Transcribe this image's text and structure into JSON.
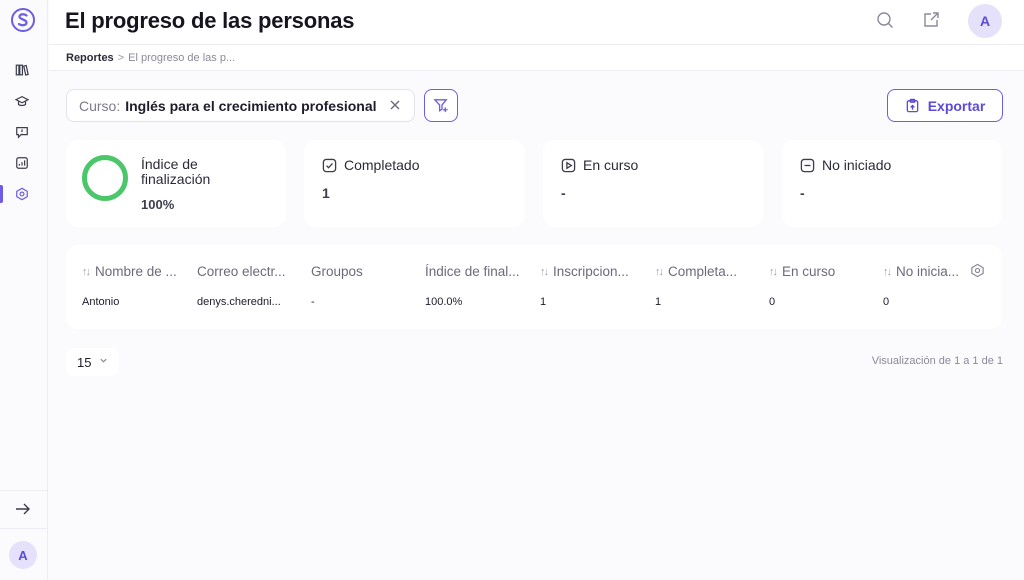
{
  "header": {
    "title": "El progreso de las personas",
    "avatar_initial": "A"
  },
  "breadcrumb": {
    "root": "Reportes",
    "separator": ">",
    "current": "El progreso de las p..."
  },
  "filter": {
    "key": "Curso:",
    "value": "Inglés para el crecimiento profesional"
  },
  "export_label": "Exportar",
  "stats": {
    "completion": {
      "title": "Índice de finalización",
      "value": "100%",
      "progress": 1.0,
      "color": "#4cc66b"
    },
    "completed": {
      "title": "Completado",
      "value": "1"
    },
    "in_progress": {
      "title": "En curso",
      "value": "-"
    },
    "not_started": {
      "title": "No iniciado",
      "value": "-"
    }
  },
  "table": {
    "columns": [
      {
        "label": "Nombre de ...",
        "sortable": true
      },
      {
        "label": "Correo electr...",
        "sortable": false
      },
      {
        "label": "Groupos",
        "sortable": false
      },
      {
        "label": "Índice de final...",
        "sortable": false
      },
      {
        "label": "Inscripcion...",
        "sortable": true
      },
      {
        "label": "Completa...",
        "sortable": true
      },
      {
        "label": "En curso",
        "sortable": true
      },
      {
        "label": "No inicia...",
        "sortable": true
      }
    ],
    "rows": [
      [
        "Antonio",
        "denys.cheredni...",
        "-",
        "100.0%",
        "1",
        "1",
        "0",
        "0"
      ]
    ]
  },
  "pagination": {
    "page_size": "15",
    "info": "Visualización de 1 a 1 de 1"
  },
  "sidebar": {
    "avatar_initial": "A",
    "items": [
      "library-icon",
      "graduation-cap-icon",
      "feedback-icon",
      "analytics-icon",
      "settings-hex-icon"
    ]
  },
  "colors": {
    "accent": "#6c5ce7",
    "success": "#4cc66b"
  }
}
